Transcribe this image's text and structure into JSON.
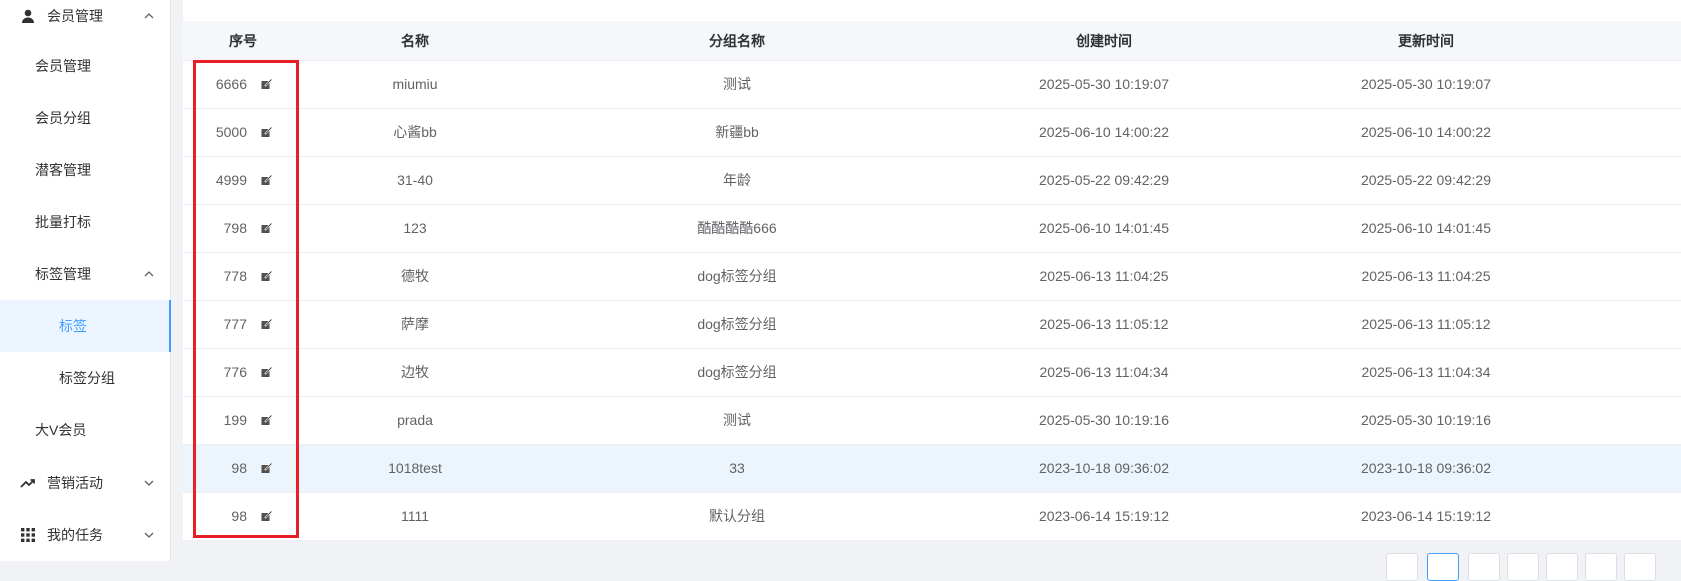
{
  "sidebar": {
    "member_group_label": "会员管理",
    "items": [
      {
        "label": "会员管理"
      },
      {
        "label": "会员分组"
      },
      {
        "label": "潜客管理"
      },
      {
        "label": "批量打标"
      },
      {
        "label": "标签管理"
      },
      {
        "label": "标签"
      },
      {
        "label": "标签分组"
      },
      {
        "label": "大V会员"
      }
    ],
    "marketing_label": "营销活动",
    "tasks_label": "我的任务"
  },
  "table": {
    "headers": [
      "序号",
      "名称",
      "分组名称",
      "创建时间",
      "更新时间"
    ],
    "rows": [
      {
        "seq": "6666",
        "name": "miumiu",
        "group": "测试",
        "created": "2025-05-30 10:19:07",
        "updated": "2025-05-30 10:19:07"
      },
      {
        "seq": "5000",
        "name": "心酱bb",
        "group": "新疆bb",
        "created": "2025-06-10 14:00:22",
        "updated": "2025-06-10 14:00:22"
      },
      {
        "seq": "4999",
        "name": "31-40",
        "group": "年龄",
        "created": "2025-05-22 09:42:29",
        "updated": "2025-05-22 09:42:29"
      },
      {
        "seq": "798",
        "name": "123",
        "group": "酷酷酷酷666",
        "created": "2025-06-10 14:01:45",
        "updated": "2025-06-10 14:01:45"
      },
      {
        "seq": "778",
        "name": "德牧",
        "group": "dog标签分组",
        "created": "2025-06-13 11:04:25",
        "updated": "2025-06-13 11:04:25"
      },
      {
        "seq": "777",
        "name": "萨摩",
        "group": "dog标签分组",
        "created": "2025-06-13 11:05:12",
        "updated": "2025-06-13 11:05:12"
      },
      {
        "seq": "776",
        "name": "边牧",
        "group": "dog标签分组",
        "created": "2025-06-13 11:04:34",
        "updated": "2025-06-13 11:04:34"
      },
      {
        "seq": "199",
        "name": "prada",
        "group": "测试",
        "created": "2025-05-30 10:19:16",
        "updated": "2025-05-30 10:19:16"
      },
      {
        "seq": "98",
        "name": "1018test",
        "group": "33",
        "created": "2023-10-18 09:36:02",
        "updated": "2023-10-18 09:36:02"
      },
      {
        "seq": "98",
        "name": "1111",
        "group": "默认分组",
        "created": "2023-06-14 15:19:12",
        "updated": "2023-06-14 15:19:12"
      }
    ]
  },
  "colors": {
    "accent": "#409eff",
    "highlight_border": "#e62026",
    "hover_row": "#ecf5fb"
  },
  "icons": [
    "user-icon",
    "chevron-up-icon",
    "chevron-down-icon",
    "trend-icon",
    "grid-icon",
    "edit-icon"
  ]
}
